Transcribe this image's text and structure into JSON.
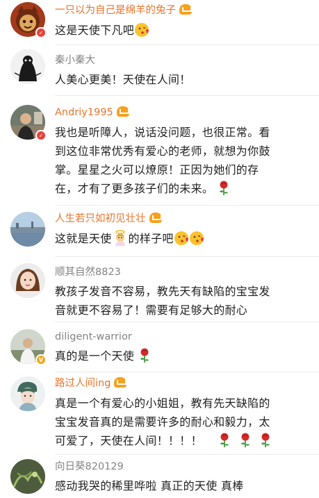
{
  "comments": [
    {
      "username": "一只以为自己是绵羊的兔子",
      "name_style": "orange",
      "vip": true,
      "badge": "red",
      "lines": [
        "这是天使下凡吧"
      ],
      "emojis": [
        "kiss-emoji"
      ]
    },
    {
      "username": "秦小秦大",
      "name_style": "gray",
      "vip": false,
      "badge": null,
      "lines": [
        "人美心更美！天使在人间！"
      ]
    },
    {
      "username": "Andriy1995",
      "name_style": "orange",
      "vip": true,
      "badge": "red",
      "lines": [
        "我也是听障人，说话没问题，也很正常。看",
        "到这位非常优秀有爱心的老师，就想为你鼓",
        "掌。星星之火可以燎原！正因为她们的存",
        "在，才有了更多孩子们的未来。"
      ],
      "emojis": [
        "rose-emoji"
      ]
    },
    {
      "username": "人生若只如初见壮壮",
      "name_style": "orange",
      "vip": true,
      "badge": null,
      "lines": [
        "这就是天使",
        "的样子吧"
      ],
      "emojis": [
        "angel-emoji",
        "kiss-emoji",
        "kiss-emoji"
      ]
    },
    {
      "username": "顺其自然8823",
      "name_style": "gray",
      "vip": false,
      "badge": null,
      "lines": [
        "教孩子发音不容易，教先天有缺陷的宝宝发",
        "音就更不容易了！需要有足够大的耐心"
      ]
    },
    {
      "username": "diligent-warrior",
      "name_style": "gray",
      "vip": false,
      "badge": "gold",
      "lines": [
        "真的是一个天使"
      ],
      "emojis": [
        "rose-emoji"
      ]
    },
    {
      "username": "路过人间ing",
      "name_style": "orange",
      "vip": true,
      "badge": null,
      "lines": [
        "真是一个有爱心的小姐姐，教有先天缺陷的",
        "宝宝发音真的是需要许多的耐心和毅力，太",
        "可爱了，天使在人间！！！！"
      ],
      "emojis": [
        "rose-emoji",
        "rose-emoji",
        "rose-emoji"
      ]
    },
    {
      "username": "向日葵820129",
      "name_style": "gray",
      "vip": false,
      "badge": null,
      "lines": [
        "感动我哭的稀里哗啦 真正的天使 真棒"
      ]
    }
  ],
  "colors": {
    "orange_name": "#e8752b",
    "gray_name": "#838383",
    "text": "#1f1f1f",
    "badge_red": "#e8413c",
    "badge_gold": "#f2a91f"
  }
}
